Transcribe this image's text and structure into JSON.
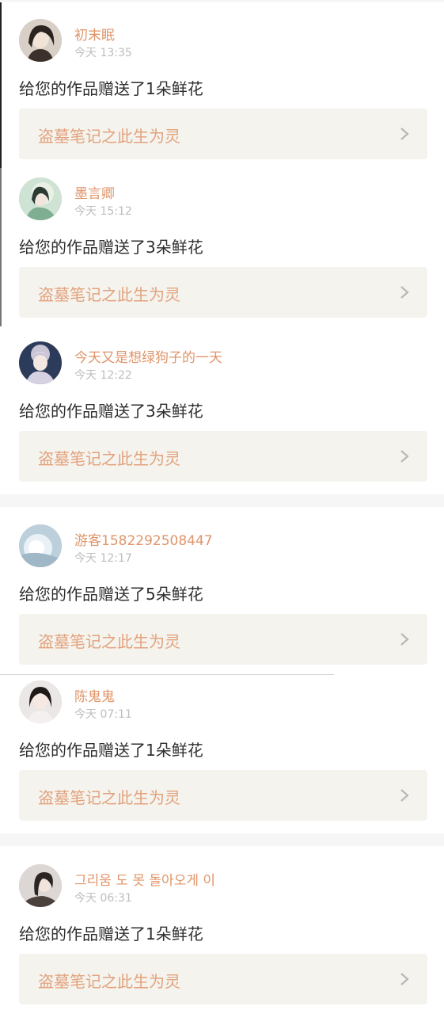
{
  "notifications": [
    {
      "username": "初末眠",
      "time": "今天 13:35",
      "message": "给您的作品赠送了1朵鲜花",
      "work_title": "盗墓笔记之此生为灵"
    },
    {
      "username": "墨言卿",
      "time": "今天 15:12",
      "message": "给您的作品赠送了3朵鲜花",
      "work_title": "盗墓笔记之此生为灵"
    },
    {
      "username": "今天又是想绿狗子的一天",
      "time": "今天 12:22",
      "message": "给您的作品赠送了3朵鲜花",
      "work_title": "盗墓笔记之此生为灵"
    },
    {
      "username": "游客1582292508447",
      "time": "今天 12:17",
      "message": "给您的作品赠送了5朵鲜花",
      "work_title": "盗墓笔记之此生为灵"
    },
    {
      "username": "陈鬼鬼",
      "time": "今天 07:11",
      "message": "给您的作品赠送了1朵鲜花",
      "work_title": "盗墓笔记之此生为灵"
    },
    {
      "username": "그리움 도 못 돌아오게 이",
      "time": "今天 06:31",
      "message": "给您的作品赠送了1朵鲜花",
      "work_title": "盗墓笔记之此生为灵"
    }
  ],
  "icons": {
    "chevron": "chevron-right-icon",
    "avatar": "avatar"
  },
  "colors": {
    "username": "#e0956a",
    "work_title": "#e3a27c",
    "card_bg": "#f4f3ee",
    "time": "#bdbdbd",
    "message": "#2e2e2e"
  }
}
